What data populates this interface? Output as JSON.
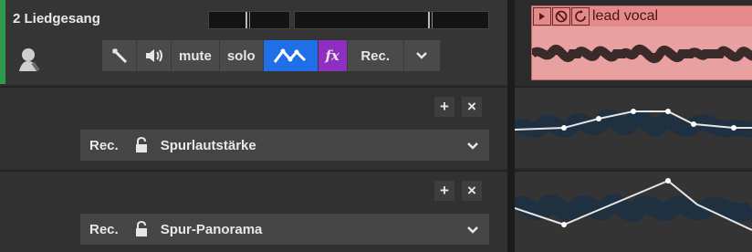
{
  "track": {
    "name": "2 Liedgesang",
    "color": "#2e9b4b",
    "buttons": {
      "mute": "mute",
      "solo": "solo",
      "fx": "fx",
      "rec": "Rec."
    }
  },
  "lanes": [
    {
      "rec": "Rec.",
      "name": "Spurlautstärke",
      "add": "+",
      "close": "×"
    },
    {
      "rec": "Rec.",
      "name": "Spur-Panorama",
      "add": "+",
      "close": "×"
    }
  ],
  "clip": {
    "title": "lead vocal",
    "color": "#e8a0a0"
  },
  "icons": {
    "play": "play-icon",
    "mute_clip": "no-icon",
    "loop": "loop-icon",
    "wrench": "wrench-icon",
    "speaker": "speaker-icon",
    "automation": "automation-icon",
    "lock": "lock-icon",
    "chevron": "chevron-down-icon",
    "avatar": "singer-avatar"
  }
}
